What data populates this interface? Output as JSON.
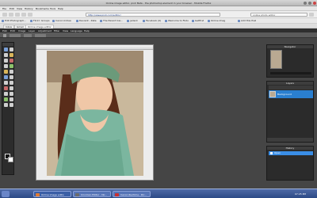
{
  "window": {
    "title": "Online image editor, pixlr Beta - the photoshop element in your browser - Mozilla Firefox"
  },
  "browser_menu": [
    "File",
    "Edit",
    "View",
    "History",
    "Bookmarks",
    "Tools",
    "Help"
  ],
  "nav": {
    "url_value": "http://www.pixlr.com/editor/",
    "search_placeholder": "online photo editor"
  },
  "bookmarks": [
    {
      "label": "Edit Photograph..."
    },
    {
      "label": "Flickr: Groups"
    },
    {
      "label": "Canon Indiaa"
    },
    {
      "label": "Deviant - Rate"
    },
    {
      "label": "The Parent Insi..."
    },
    {
      "label": "jadeck"
    },
    {
      "label": "Facebook (0)"
    },
    {
      "label": "Welcome to Fbdo"
    },
    {
      "label": "Getfirst"
    },
    {
      "label": "Online Imag"
    },
    {
      "label": "Add this Post"
    }
  ],
  "browser_tabs": [
    {
      "label": "Inbox"
    },
    {
      "label": "Gmail"
    },
    {
      "label": "Online image editor"
    }
  ],
  "app_menu": [
    "Pixlr",
    "Edit",
    "Image",
    "Layer",
    "Adjustment",
    "Filter",
    "View",
    "Language",
    "Help"
  ],
  "colors": {
    "accent": "#2a7fd0",
    "selected": "#3a8ee6"
  },
  "icons": [
    "back-icon",
    "forward-icon",
    "reload-icon",
    "stop-icon",
    "home-icon",
    "search-icon",
    "bookmark-icon",
    "marquee-tool-icon",
    "lasso-tool-icon",
    "move-tool-icon",
    "brush-tool-icon",
    "eraser-tool-icon",
    "clone-tool-icon",
    "text-tool-icon",
    "zoom-tool-icon",
    "foreground-color-swatch",
    "background-color-swatch",
    "layer-thumbnail-icon",
    "history-icon"
  ],
  "panels": {
    "navigator": {
      "title": "Navigator"
    },
    "layers": {
      "title": "Layers",
      "items": [
        {
          "name": "Background"
        }
      ]
    },
    "history": {
      "title": "History",
      "items": [
        {
          "label": "Open"
        }
      ]
    }
  },
  "taskbar": {
    "tasks": [
      {
        "label": "Online image edito"
      },
      {
        "label": "Cinnmon Editor - Dir..."
      },
      {
        "label": "Canon Runtime - Dir..."
      }
    ],
    "clock": "07:25 PM"
  }
}
